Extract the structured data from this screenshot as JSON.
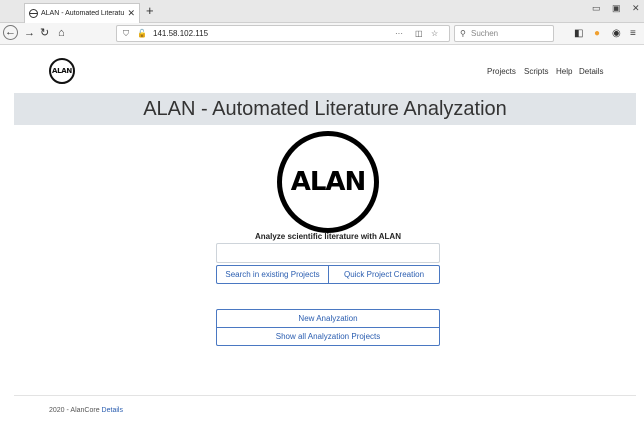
{
  "browser": {
    "tab_title": "ALAN - Automated Literature",
    "address": "141.58.102.115",
    "search_placeholder": "Suchen",
    "overflow_glyph": "···"
  },
  "nav": {
    "items": [
      {
        "label": "Projects"
      },
      {
        "label": "Scripts"
      },
      {
        "label": "Help"
      },
      {
        "label": "Details"
      }
    ]
  },
  "logo_text": "ALAN",
  "banner_title": "ALAN - Automated Literature Analyzation",
  "main": {
    "tagline": "Analyze scientific literature with ALAN",
    "search_value": "",
    "buttons": {
      "search_existing": "Search in existing Projects",
      "quick_create": "Quick Project Creation",
      "new_analyzation": "New Analyzation",
      "show_all": "Show all Analyzation Projects"
    }
  },
  "footer": {
    "prefix": "2020 - AlanCore",
    "link": "Details"
  },
  "colors": {
    "accent": "#2a5db0",
    "banner_bg": "#e0e4e8"
  }
}
